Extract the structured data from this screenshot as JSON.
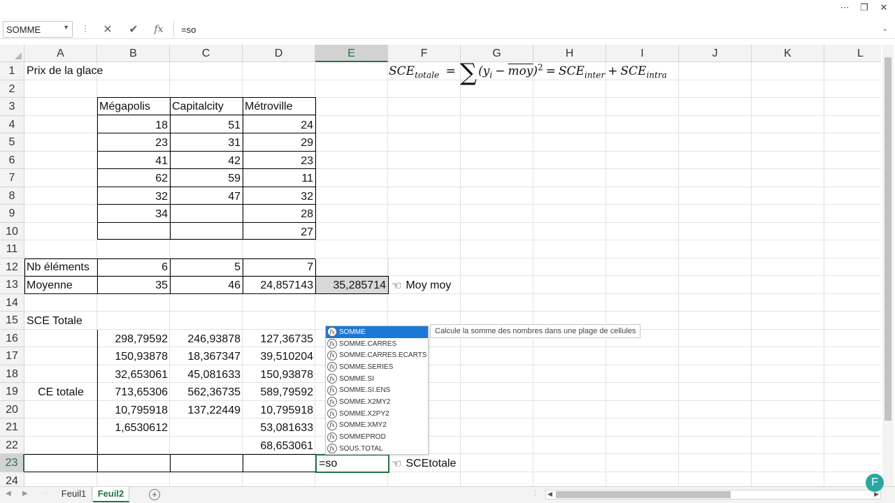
{
  "window": {
    "help_icon": "ribbon-options",
    "restore_icon": "restore-icon",
    "close_icon": "close-icon"
  },
  "formula_bar": {
    "name_box": "SOMME",
    "formula": "=so",
    "cancel": "✕",
    "enter": "✔",
    "fx": "fx"
  },
  "columns": [
    "A",
    "B",
    "C",
    "D",
    "E",
    "F",
    "G",
    "H",
    "I",
    "J",
    "K",
    "L"
  ],
  "rows": [
    "1",
    "2",
    "3",
    "4",
    "5",
    "6",
    "7",
    "8",
    "9",
    "10",
    "11",
    "12",
    "13",
    "14",
    "15",
    "16",
    "17",
    "18",
    "19",
    "20",
    "21",
    "22",
    "23",
    "24"
  ],
  "sheet": {
    "title": "Prix de la glace",
    "headers": [
      "Mégapolis",
      "Capitalcity",
      "Métroville"
    ],
    "megapolis": [
      "18",
      "23",
      "41",
      "62",
      "32",
      "34"
    ],
    "capitalcity": [
      "51",
      "31",
      "42",
      "59",
      "47"
    ],
    "metroville": [
      "24",
      "29",
      "23",
      "11",
      "32",
      "28",
      "27"
    ],
    "nb_label": "Nb éléments",
    "nb_values": [
      "6",
      "5",
      "7"
    ],
    "moy_label": "Moyenne",
    "moy_values": [
      "35",
      "46",
      "24,857143"
    ],
    "moy_moy": "35,285714",
    "moy_moy_note": "Moy moy",
    "sce_label": "SCE Totale",
    "ce_label": "CE totale",
    "ce_b": [
      "298,79592",
      "150,93878",
      "32,653061",
      "713,65306",
      "10,795918",
      "1,6530612"
    ],
    "ce_c": [
      "246,93878",
      "18,367347",
      "45,081633",
      "562,36735",
      "137,22449"
    ],
    "ce_d": [
      "127,36735",
      "39,510204",
      "150,93878",
      "589,79592",
      "10,795918",
      "53,081633",
      "68,653061"
    ],
    "active_entry": "=so",
    "sce_note": "SCEtotale"
  },
  "equation": {
    "lhs": "SCE",
    "lhs_sub": "totale",
    "sum": "∑",
    "open": "(",
    "y": "y",
    "y_sub": "i",
    "minus": "−",
    "moy": "moy",
    "close": ")",
    "sq": "2",
    "eq1": "=",
    "inter": "SCE",
    "inter_sub": "inter",
    "plus": "+",
    "intra": "SCE",
    "intra_sub": "intra"
  },
  "autocomplete": {
    "items": [
      "SOMME",
      "SOMME.CARRES",
      "SOMME.CARRES.ECARTS",
      "SOMME.SERIES",
      "SOMME.SI",
      "SOMME.SI.ENS",
      "SOMME.X2MY2",
      "SOMME.X2PY2",
      "SOMME.XMY2",
      "SOMMEPROD",
      "SOUS.TOTAL"
    ],
    "tooltip": "Calcule la somme des nombres dans une plage de cellules"
  },
  "tabs": {
    "sheets": [
      "Feuil1",
      "Feuil2"
    ],
    "active": "Feuil2",
    "add": "+"
  },
  "user": {
    "initial": "F"
  },
  "colors": {
    "accent": "#217346",
    "autocomplete_highlight": "#1c78d7"
  }
}
